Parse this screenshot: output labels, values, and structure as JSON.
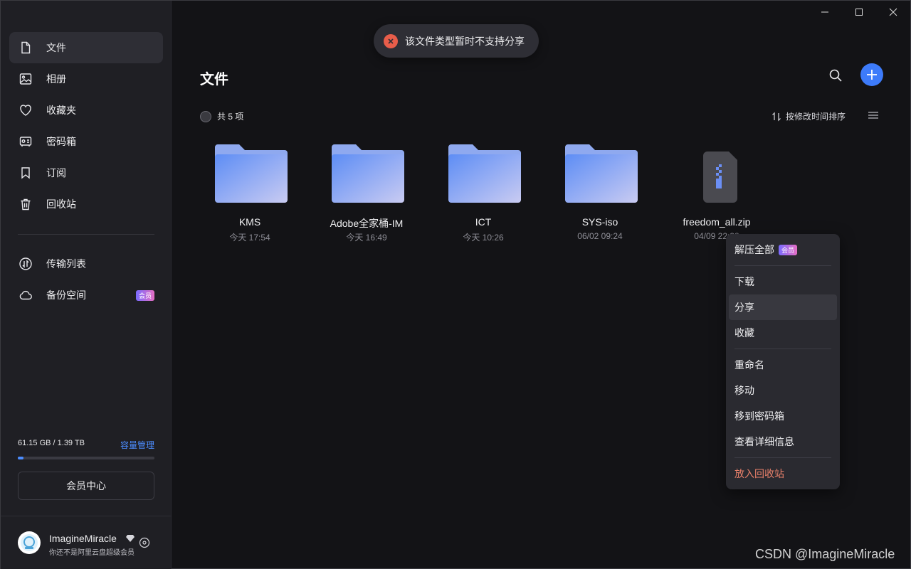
{
  "window": {
    "buttons": [
      "minimize",
      "maximize",
      "close"
    ]
  },
  "sidebar": {
    "items": [
      {
        "label": "文件",
        "icon": "file-icon",
        "active": true
      },
      {
        "label": "相册",
        "icon": "photo-icon"
      },
      {
        "label": "收藏夹",
        "icon": "heart-icon"
      },
      {
        "label": "密码箱",
        "icon": "safe-icon"
      },
      {
        "label": "订阅",
        "icon": "bookmark-icon"
      },
      {
        "label": "回收站",
        "icon": "trash-icon"
      }
    ],
    "secondary_items": [
      {
        "label": "传输列表",
        "icon": "transfer-icon"
      },
      {
        "label": "备份空间",
        "icon": "cloud-icon",
        "badge": "会员"
      }
    ],
    "storage": {
      "usage_text": "61.15 GB / 1.39 TB",
      "manage_label": "容量管理",
      "used_fraction": 0.043
    },
    "vip_center_label": "会员中心",
    "user": {
      "name": "ImagineMiracle",
      "subtitle": "你还不是阿里云盘超级会员"
    }
  },
  "main": {
    "title": "文件",
    "count_text": "共 5 项",
    "sort_label": "按修改时间排序",
    "files": [
      {
        "name": "KMS",
        "time": "今天 17:54",
        "type": "folder"
      },
      {
        "name": "Adobe全家桶-IM",
        "time": "今天 16:49",
        "type": "folder"
      },
      {
        "name": "ICT",
        "time": "今天 10:26",
        "type": "folder"
      },
      {
        "name": "SYS-iso",
        "time": "06/02 09:24",
        "type": "folder"
      },
      {
        "name": "freedom_all.zip",
        "time": "04/09 22:38",
        "type": "zip"
      }
    ]
  },
  "toast": {
    "message": "该文件类型暂时不支持分享"
  },
  "context_menu": {
    "extract_all": "解压全部",
    "extract_badge": "会员",
    "download": "下载",
    "share": "分享",
    "favorite": "收藏",
    "rename": "重命名",
    "move": "移动",
    "move_to_safe": "移到密码箱",
    "details": "查看详细信息",
    "trash": "放入回收站"
  },
  "watermark": "CSDN @ImagineMiracle",
  "colors": {
    "accent": "#3d7bfa",
    "danger": "#e8806a",
    "sidebar_bg": "#1f1f24",
    "main_bg": "#131316"
  }
}
